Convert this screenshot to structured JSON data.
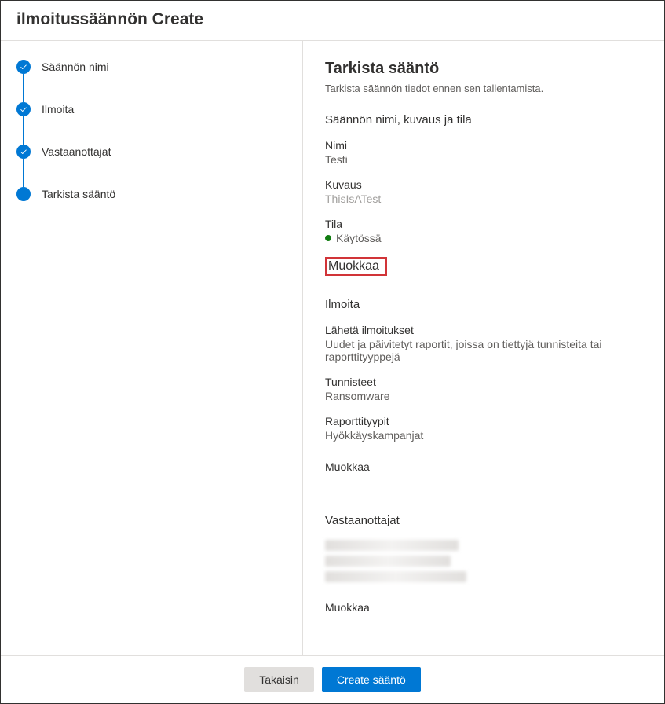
{
  "header": {
    "title": "ilmoitussäännön Create"
  },
  "steps": [
    {
      "label": "Säännön nimi",
      "state": "completed"
    },
    {
      "label": "Ilmoita",
      "state": "completed"
    },
    {
      "label": "Vastaanottajat",
      "state": "completed"
    },
    {
      "label": "Tarkista sääntö",
      "state": "current"
    }
  ],
  "main": {
    "title": "Tarkista sääntö",
    "subtitle": "Tarkista säännön tiedot ennen sen tallentamista.",
    "section1": {
      "heading": "Säännön nimi, kuvaus ja tila",
      "name_label": "Nimi",
      "name_value": "Testi",
      "desc_label": "Kuvaus",
      "desc_value": "ThisIsATest",
      "status_label": "Tila",
      "status_value": "Käytössä",
      "edit": "Muokkaa"
    },
    "section2": {
      "heading": "Ilmoita",
      "send_label": "Lähetä ilmoitukset",
      "send_value": "Uudet ja päivitetyt raportit, joissa on tiettyjä tunnisteita tai raporttityyppejä",
      "tags_label": "Tunnisteet",
      "tags_value": "Ransomware",
      "types_label": "Raporttityypit",
      "types_value": "Hyökkäyskampanjat",
      "edit": "Muokkaa"
    },
    "section3": {
      "heading": "Vastaanottajat",
      "edit": "Muokkaa"
    }
  },
  "footer": {
    "back": "Takaisin",
    "create": "Create sääntö"
  }
}
